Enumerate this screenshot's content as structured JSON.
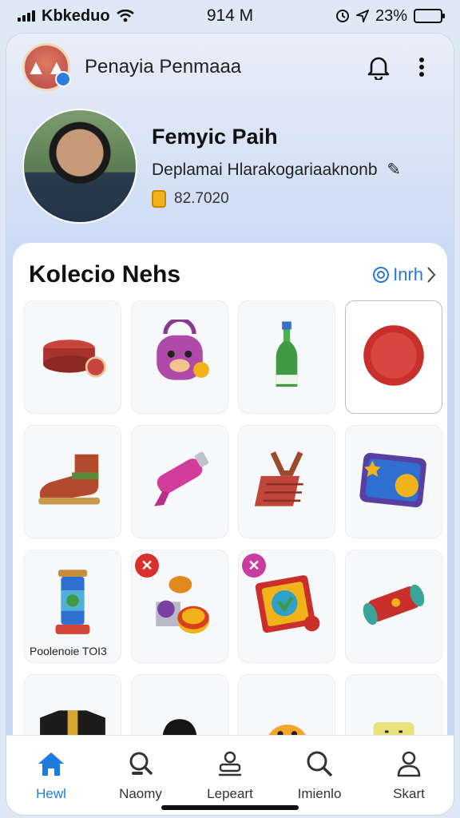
{
  "status_bar": {
    "carrier": "Kbkeduo",
    "time": "914 M",
    "battery": "23%",
    "battery_level": 0.23
  },
  "header": {
    "title": "Penayia Penmaaa",
    "notification_icon": "bell-icon",
    "menu_icon": "more-vertical-icon"
  },
  "profile": {
    "name": "Femyic Paih",
    "department": "Deplamai Hlarakogariaaknonb",
    "points": "82.7020"
  },
  "collection": {
    "title": "Kolecio Nehs",
    "more_label": "Inrh",
    "items": [
      {
        "icon": "drum-icon",
        "caption": ""
      },
      {
        "icon": "creature-bag-icon",
        "caption": ""
      },
      {
        "icon": "bottle-icon",
        "caption": ""
      },
      {
        "icon": "red-seal-icon",
        "caption": ""
      },
      {
        "icon": "boot-icon",
        "caption": ""
      },
      {
        "icon": "pink-spray-icon",
        "caption": ""
      },
      {
        "icon": "slingshot-icon",
        "caption": ""
      },
      {
        "icon": "game-board-icon",
        "caption": ""
      },
      {
        "icon": "lantern-icon",
        "caption": "Poolenoie TOI3"
      },
      {
        "icon": "coin-stack-icon",
        "caption": ""
      },
      {
        "icon": "badge-card-icon",
        "caption": ""
      },
      {
        "icon": "scroll-icon",
        "caption": ""
      },
      {
        "icon": "jacket-icon",
        "caption": ""
      },
      {
        "icon": "hat-icon",
        "caption": ""
      },
      {
        "icon": "emoji-face-icon",
        "caption": ""
      },
      {
        "icon": "block-face-icon",
        "caption": ""
      }
    ]
  },
  "bottom_nav": [
    {
      "label": "Hewl",
      "icon": "home-icon",
      "active": true
    },
    {
      "label": "Naomy",
      "icon": "search-person-icon",
      "active": false
    },
    {
      "label": "Lepeart",
      "icon": "stamp-icon",
      "active": false
    },
    {
      "label": "Imienlo",
      "icon": "search-icon",
      "active": false
    },
    {
      "label": "Skart",
      "icon": "user-icon",
      "active": false
    }
  ],
  "colors": {
    "accent": "#1e7be0",
    "panel_bg": "#ffffff",
    "header_gradient_top": "#e9eef8",
    "header_gradient_bottom": "#c9d9f5",
    "coin": "#f2b21a"
  }
}
